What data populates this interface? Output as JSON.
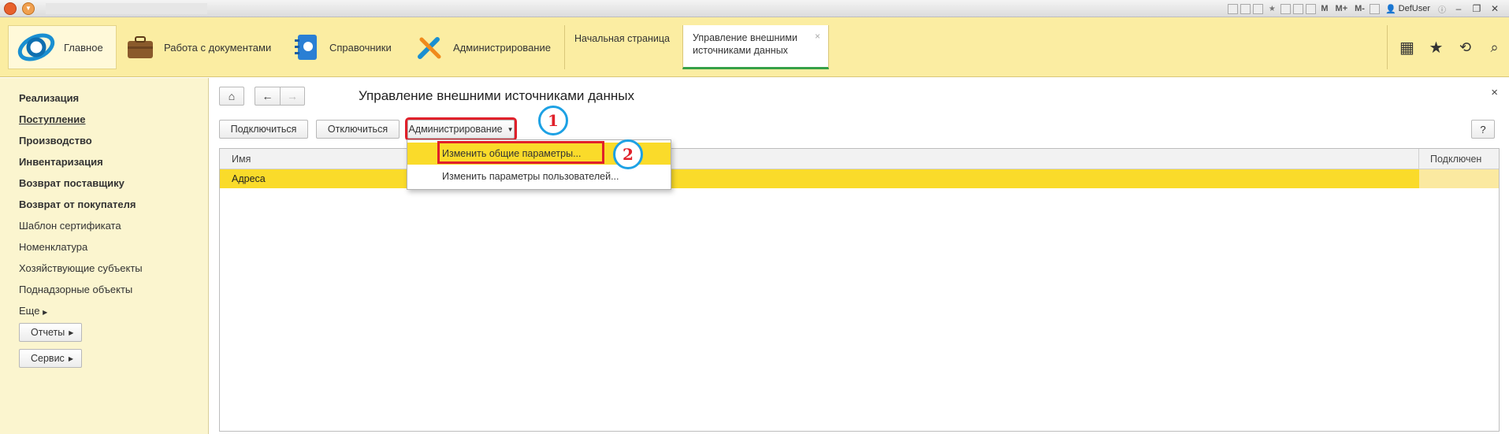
{
  "titlebar": {
    "memory_buttons": [
      "M",
      "M+",
      "M-"
    ],
    "user": "DefUser"
  },
  "sections": {
    "main": "Главное",
    "items": [
      "Работа с документами",
      "Справочники",
      "Администрирование"
    ],
    "open_tabs": [
      {
        "label_line1": "Начальная страница",
        "label_line2": ""
      },
      {
        "label_line1": "Управление внешними",
        "label_line2": "источниками данных",
        "close": "×"
      }
    ],
    "right_icons": [
      "apps-grid-icon",
      "star-icon",
      "history-icon",
      "search-icon"
    ]
  },
  "leftnav": {
    "items": [
      {
        "label": "Реализация",
        "bold": true
      },
      {
        "label": "Поступление",
        "bold": true,
        "underline": true
      },
      {
        "label": "Производство",
        "bold": true
      },
      {
        "label": "Инвентаризация",
        "bold": true
      },
      {
        "label": "Возврат поставщику",
        "bold": true
      },
      {
        "label": "Возврат от покупателя",
        "bold": true
      },
      {
        "label": "Шаблон сертификата"
      },
      {
        "label": "Номенклатура"
      },
      {
        "label": "Хозяйствующие субъекты"
      },
      {
        "label": "Поднадзорные объекты"
      }
    ],
    "more": "Еще",
    "reports": "Отчеты",
    "service": "Сервис"
  },
  "form": {
    "title": "Управление внешними источниками данных",
    "close": "×",
    "buttons": {
      "connect": "Подключиться",
      "disconnect": "Отключиться",
      "admin": "Администрирование",
      "help": "?"
    },
    "table": {
      "columns": [
        "Имя",
        "Подключен"
      ],
      "rows": [
        {
          "name": "Адреса",
          "connected": ""
        }
      ]
    },
    "menu": {
      "items": [
        "Изменить общие параметры...",
        "Изменить параметры пользователей..."
      ]
    }
  },
  "callouts": [
    "1",
    "2"
  ],
  "colors": {
    "section_panel": "#fbeda2",
    "leftnav": "#fbf5cf",
    "selection": "#fadb2a",
    "highlight_red": "#e0202a",
    "callout_blue": "#1da1e4",
    "active_tab_underline": "#36a048"
  }
}
